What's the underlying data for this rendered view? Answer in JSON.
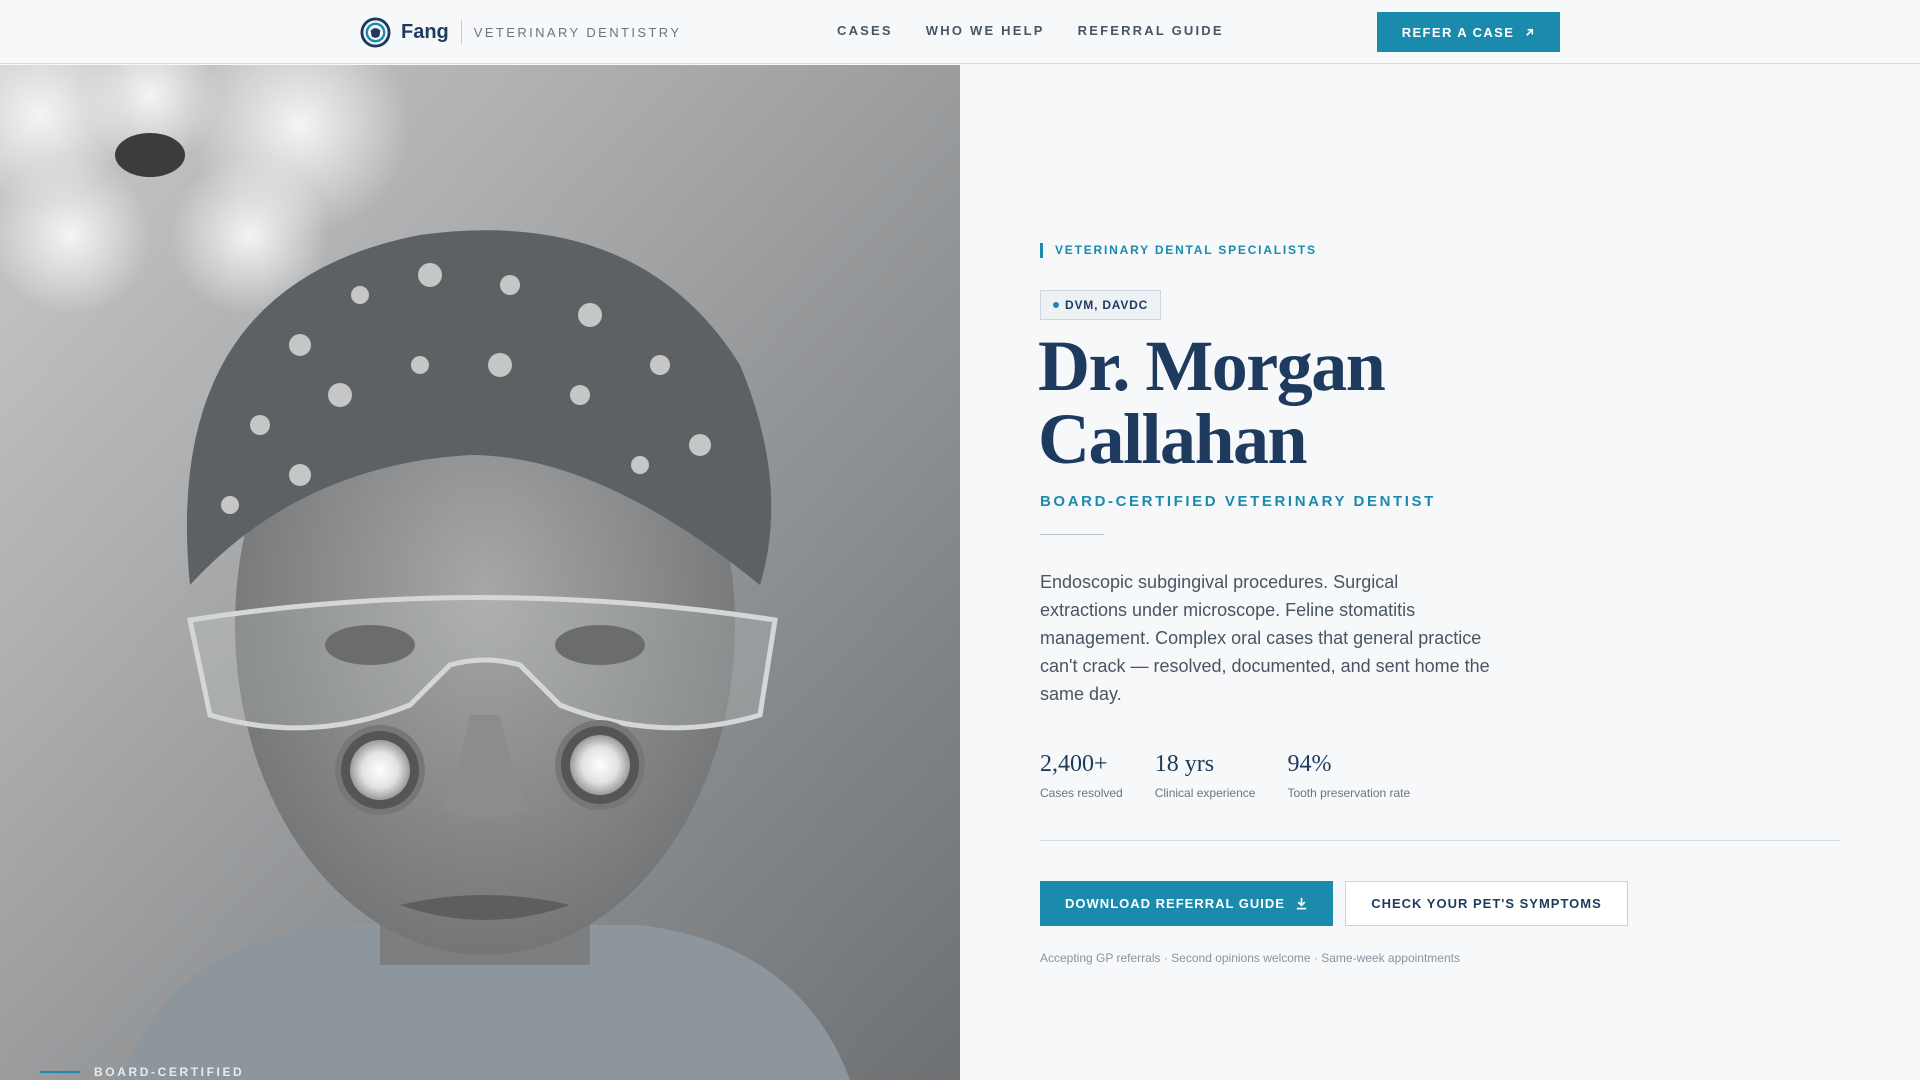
{
  "header": {
    "brand_name": "Fang",
    "brand_tagline": "VETERINARY DENTISTRY",
    "logo_icon": "tooth-ring-logo",
    "nav": [
      {
        "label": "CASES"
      },
      {
        "label": "WHO WE HELP"
      },
      {
        "label": "REFERRAL GUIDE"
      }
    ],
    "cta_label": "REFER A CASE",
    "cta_icon": "arrow-up-right-icon"
  },
  "photo": {
    "caption": "BOARD-CERTIFIED"
  },
  "hero": {
    "eyebrow": "VETERINARY DENTAL SPECIALISTS",
    "credentials": "DVM, DAVDC",
    "name_line1": "Dr. Morgan",
    "name_line2": "Callahan",
    "role": "BOARD-CERTIFIED VETERINARY DENTIST",
    "description": "Endoscopic subgingival procedures. Surgical extractions under microscope. Feline stomatitis management. Complex oral cases that general practice can't crack — resolved, documented, and sent home the same day.",
    "stats": [
      {
        "value": "2,400+",
        "label": "Cases resolved"
      },
      {
        "value": "18 yrs",
        "label": "Clinical experience"
      },
      {
        "value": "94%",
        "label": "Tooth preservation rate"
      }
    ],
    "primary_button": "DOWNLOAD REFERRAL GUIDE",
    "primary_icon": "download-icon",
    "secondary_button": "CHECK YOUR PET'S SYMPTOMS",
    "footnote": "Accepting GP referrals · Second opinions welcome · Same-week appointments"
  },
  "colors": {
    "accent": "#1a8aad",
    "navy": "#1e3a5f",
    "background": "#f6f8fa"
  }
}
